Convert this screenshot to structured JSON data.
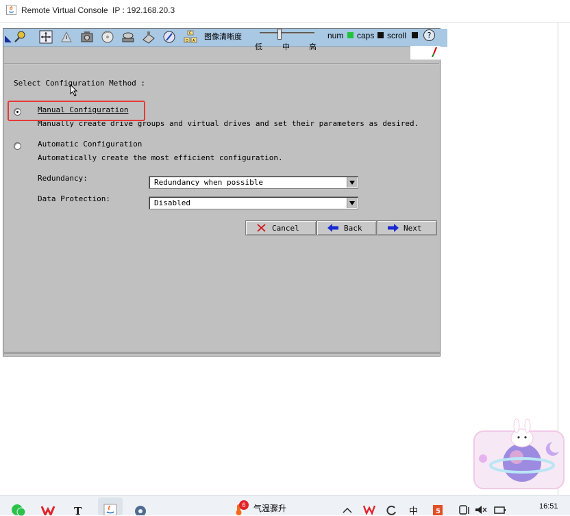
{
  "window": {
    "title": "Remote Virtual Console",
    "ip": "IP : 192.168.20.3"
  },
  "toolbar": {
    "quality_label": "图像清晰度",
    "quality_low": "低",
    "quality_mid": "中",
    "quality_high": "高",
    "num_label": "num",
    "num_color": "#22c33a",
    "caps_label": "caps",
    "caps_color": "#111111",
    "scroll_label": "scroll",
    "scroll_color": "#111111",
    "help_label": "?",
    "icons": [
      "connect-icon",
      "move-icon",
      "warning-icon",
      "camera-icon",
      "cd-icon",
      "drive-icon",
      "floppy-icon",
      "dvd-icon",
      "cda-icon"
    ]
  },
  "wizard": {
    "prompt": "Select Configuration Method :",
    "options": [
      {
        "label": "Manual Configuration",
        "description": "Manually create drive groups and virtual drives and set their parameters as desired.",
        "selected": true
      },
      {
        "label": "Automatic Configuration",
        "description": "Automatically create the most efficient configuration.",
        "selected": false
      }
    ],
    "redundancy_label": "Redundancy:",
    "redundancy_value": "Redundancy when possible",
    "protection_label": "Data Protection:",
    "protection_value": "Disabled",
    "buttons": {
      "cancel": "Cancel",
      "back": "Back",
      "next": "Next"
    }
  },
  "taskbar": {
    "weather_badge": "6",
    "weather_text": "气温骤升",
    "clock": "16:51"
  }
}
